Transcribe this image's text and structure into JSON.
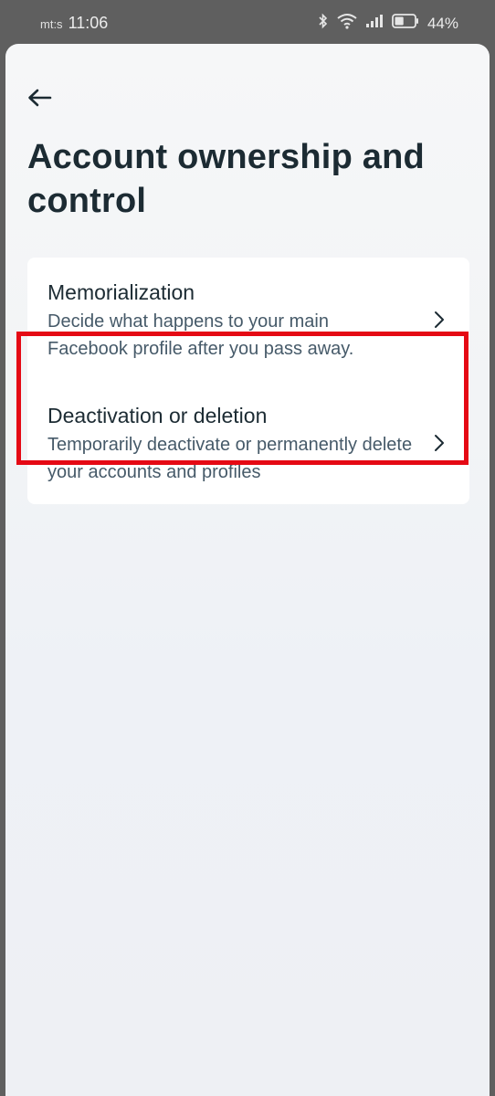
{
  "status_bar": {
    "carrier": "mt:s",
    "time": "11:06",
    "battery_percent": "44%",
    "icons": [
      "bluetooth-icon",
      "wifi-icon",
      "signal-icon",
      "battery-icon"
    ],
    "battery_level": 0.44
  },
  "header": {
    "back_icon": "arrow-left-icon",
    "title": "Account ownership and control"
  },
  "options": [
    {
      "title": "Memorialization",
      "subtitle": "Decide what happens to your main Facebook profile after you pass away.",
      "icon": "chevron-right-icon"
    },
    {
      "title": "Deactivation or deletion",
      "subtitle": "Temporarily deactivate or permanently delete your accounts and profiles",
      "icon": "chevron-right-icon",
      "highlighted": true
    }
  ],
  "colors": {
    "highlight": "#e50914",
    "title_text": "#1c2b33",
    "subtitle_text": "#465a69"
  }
}
